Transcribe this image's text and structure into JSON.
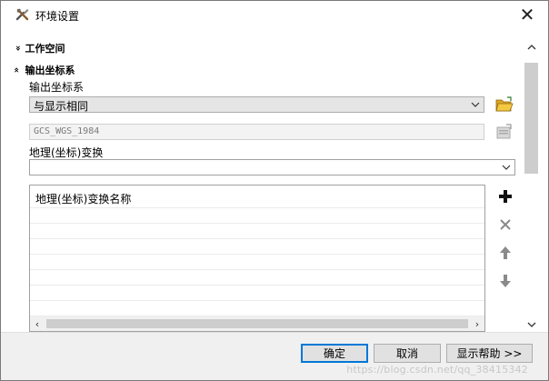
{
  "window": {
    "title": "环境设置",
    "close_glyph": "✕"
  },
  "sections": {
    "workspace": {
      "chevron": "»",
      "label": "工作空间",
      "expanded": false
    },
    "output_cs": {
      "chevron": "»",
      "label": "输出坐标系",
      "expanded": true
    }
  },
  "output_cs": {
    "field_label": "输出坐标系",
    "combo_value": "与显示相同",
    "readonly_value": "GCS_WGS_1984",
    "geo_transform_label": "地理(坐标)变换",
    "geo_transform_value": "",
    "list_header": "地理(坐标)变换名称"
  },
  "side_buttons": [
    "add-icon",
    "remove-icon",
    "move-up-icon",
    "move-down-icon"
  ],
  "footer": {
    "ok_label": "确定",
    "cancel_label": "取消",
    "help_label": "显示帮助 >>",
    "watermark": "https://blog.csdn.net/qq_38415342"
  },
  "colors": {
    "accent": "#0078d7",
    "footer_bg": "#f0f0f0",
    "add_icon": "#111111",
    "disabled_icon": "#8a8a8a"
  }
}
